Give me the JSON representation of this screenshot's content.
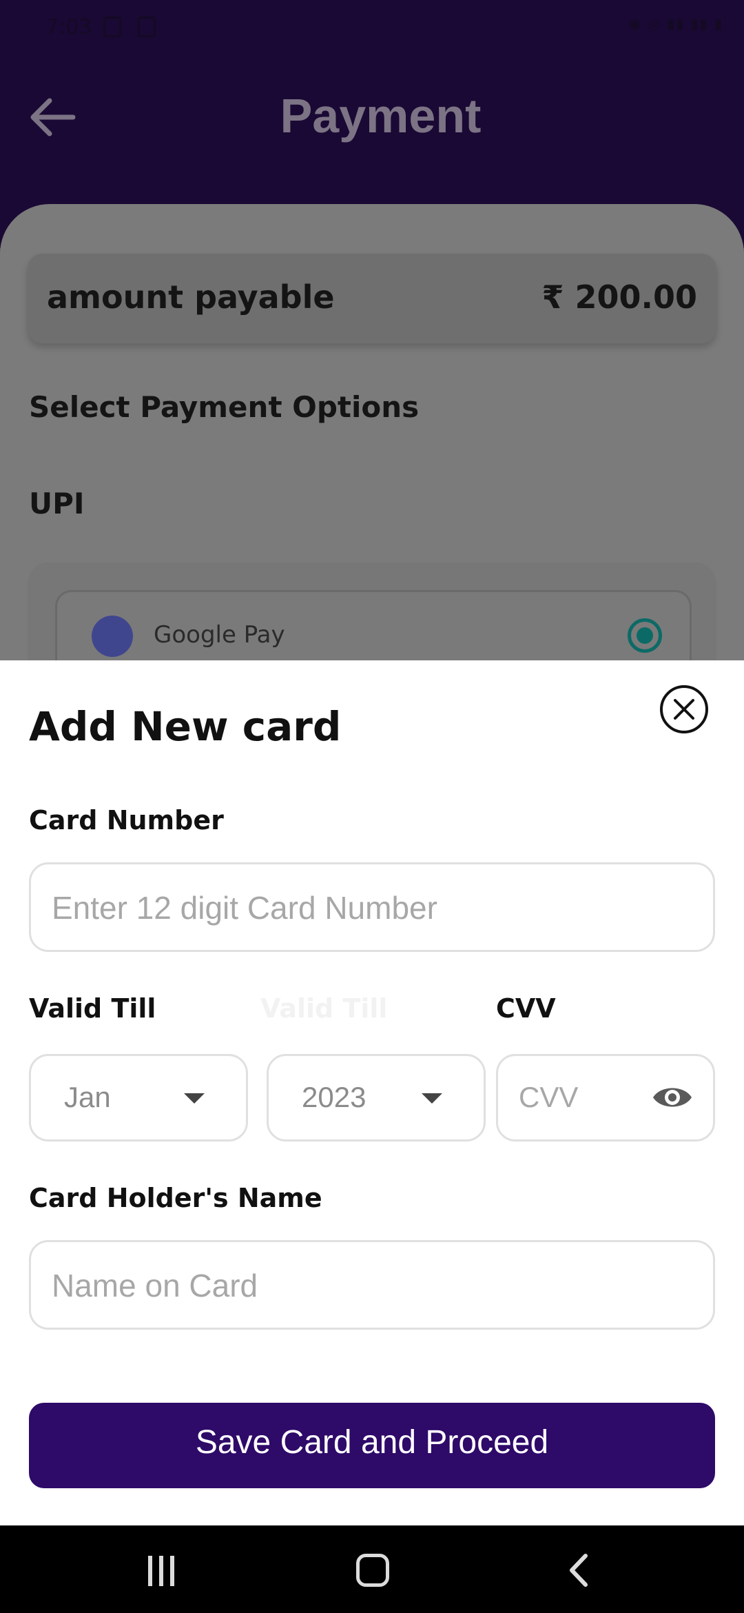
{
  "status_bar": {
    "time": "7:03"
  },
  "header": {
    "title": "Payment"
  },
  "amount": {
    "label": "amount payable",
    "value": "₹ 200.00"
  },
  "select_options_title": "Select Payment Options",
  "upi": {
    "label": "UPI",
    "options": [
      {
        "name": "Google Pay",
        "selected": true
      }
    ]
  },
  "add_card": {
    "title": "Add New card",
    "card_number": {
      "label": "Card Number",
      "placeholder": "Enter 12 digit Card Number"
    },
    "valid_till": {
      "label": "Valid Till",
      "label_ghost": "Valid Till",
      "month": "Jan",
      "year": "2023"
    },
    "cvv": {
      "label": "CVV",
      "placeholder": "CVV"
    },
    "holder": {
      "label": "Card Holder's Name",
      "placeholder": "Name on Card"
    },
    "save_button": "Save Card and Proceed"
  },
  "colors": {
    "header_bg": "#1a0934",
    "button_bg": "#2e0a69",
    "radio": "#0c6a66"
  },
  "icons": [
    "back-arrow-icon",
    "close-icon",
    "dropdown-caret-icon",
    "eye-icon",
    "google-pay-icon"
  ]
}
